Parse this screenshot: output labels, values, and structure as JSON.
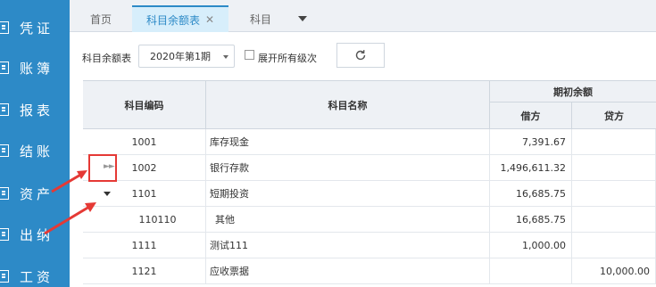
{
  "sidebar": {
    "items": [
      {
        "label": "凭证",
        "icon": "doc-icon"
      },
      {
        "label": "账簿",
        "icon": "book-icon"
      },
      {
        "label": "报表",
        "icon": "report-icon"
      },
      {
        "label": "结账",
        "icon": "check-icon"
      },
      {
        "label": "资产",
        "icon": "asset-icon"
      },
      {
        "label": "出纳",
        "icon": "cashier-icon"
      },
      {
        "label": "工资",
        "icon": "salary-icon"
      }
    ],
    "color": "#2d8ac7"
  },
  "tabs": [
    {
      "label": "首页"
    },
    {
      "label": "科目余额表",
      "active": true,
      "close": "✕"
    },
    {
      "label": "科目"
    }
  ],
  "toolbar": {
    "label": "科目余额表",
    "period": "2020年第1期",
    "expand_label": "展开所有级次",
    "expand_checked": false
  },
  "table": {
    "headers": {
      "code": "科目编码",
      "name": "科目名称",
      "opening": "期初余额",
      "debit": "借方",
      "credit": "贷方"
    },
    "rows": [
      {
        "code": "1001",
        "name": "库存现金",
        "debit": "7,391.67",
        "credit": ""
      },
      {
        "code": "1002",
        "name": "银行存款",
        "debit": "1,496,611.32",
        "credit": "",
        "tree": "collapsed"
      },
      {
        "code": "1101",
        "name": "短期投资",
        "debit": "16,685.75",
        "credit": "",
        "tree": "expanded"
      },
      {
        "code": "110110",
        "name": "其他",
        "debit": "16,685.75",
        "credit": "",
        "child": true
      },
      {
        "code": "1111",
        "name": "测试111",
        "debit": "1,000.00",
        "credit": ""
      },
      {
        "code": "1121",
        "name": "应收票据",
        "debit": "",
        "credit": "10,000.00"
      }
    ]
  },
  "annotation_color": "#e53935"
}
